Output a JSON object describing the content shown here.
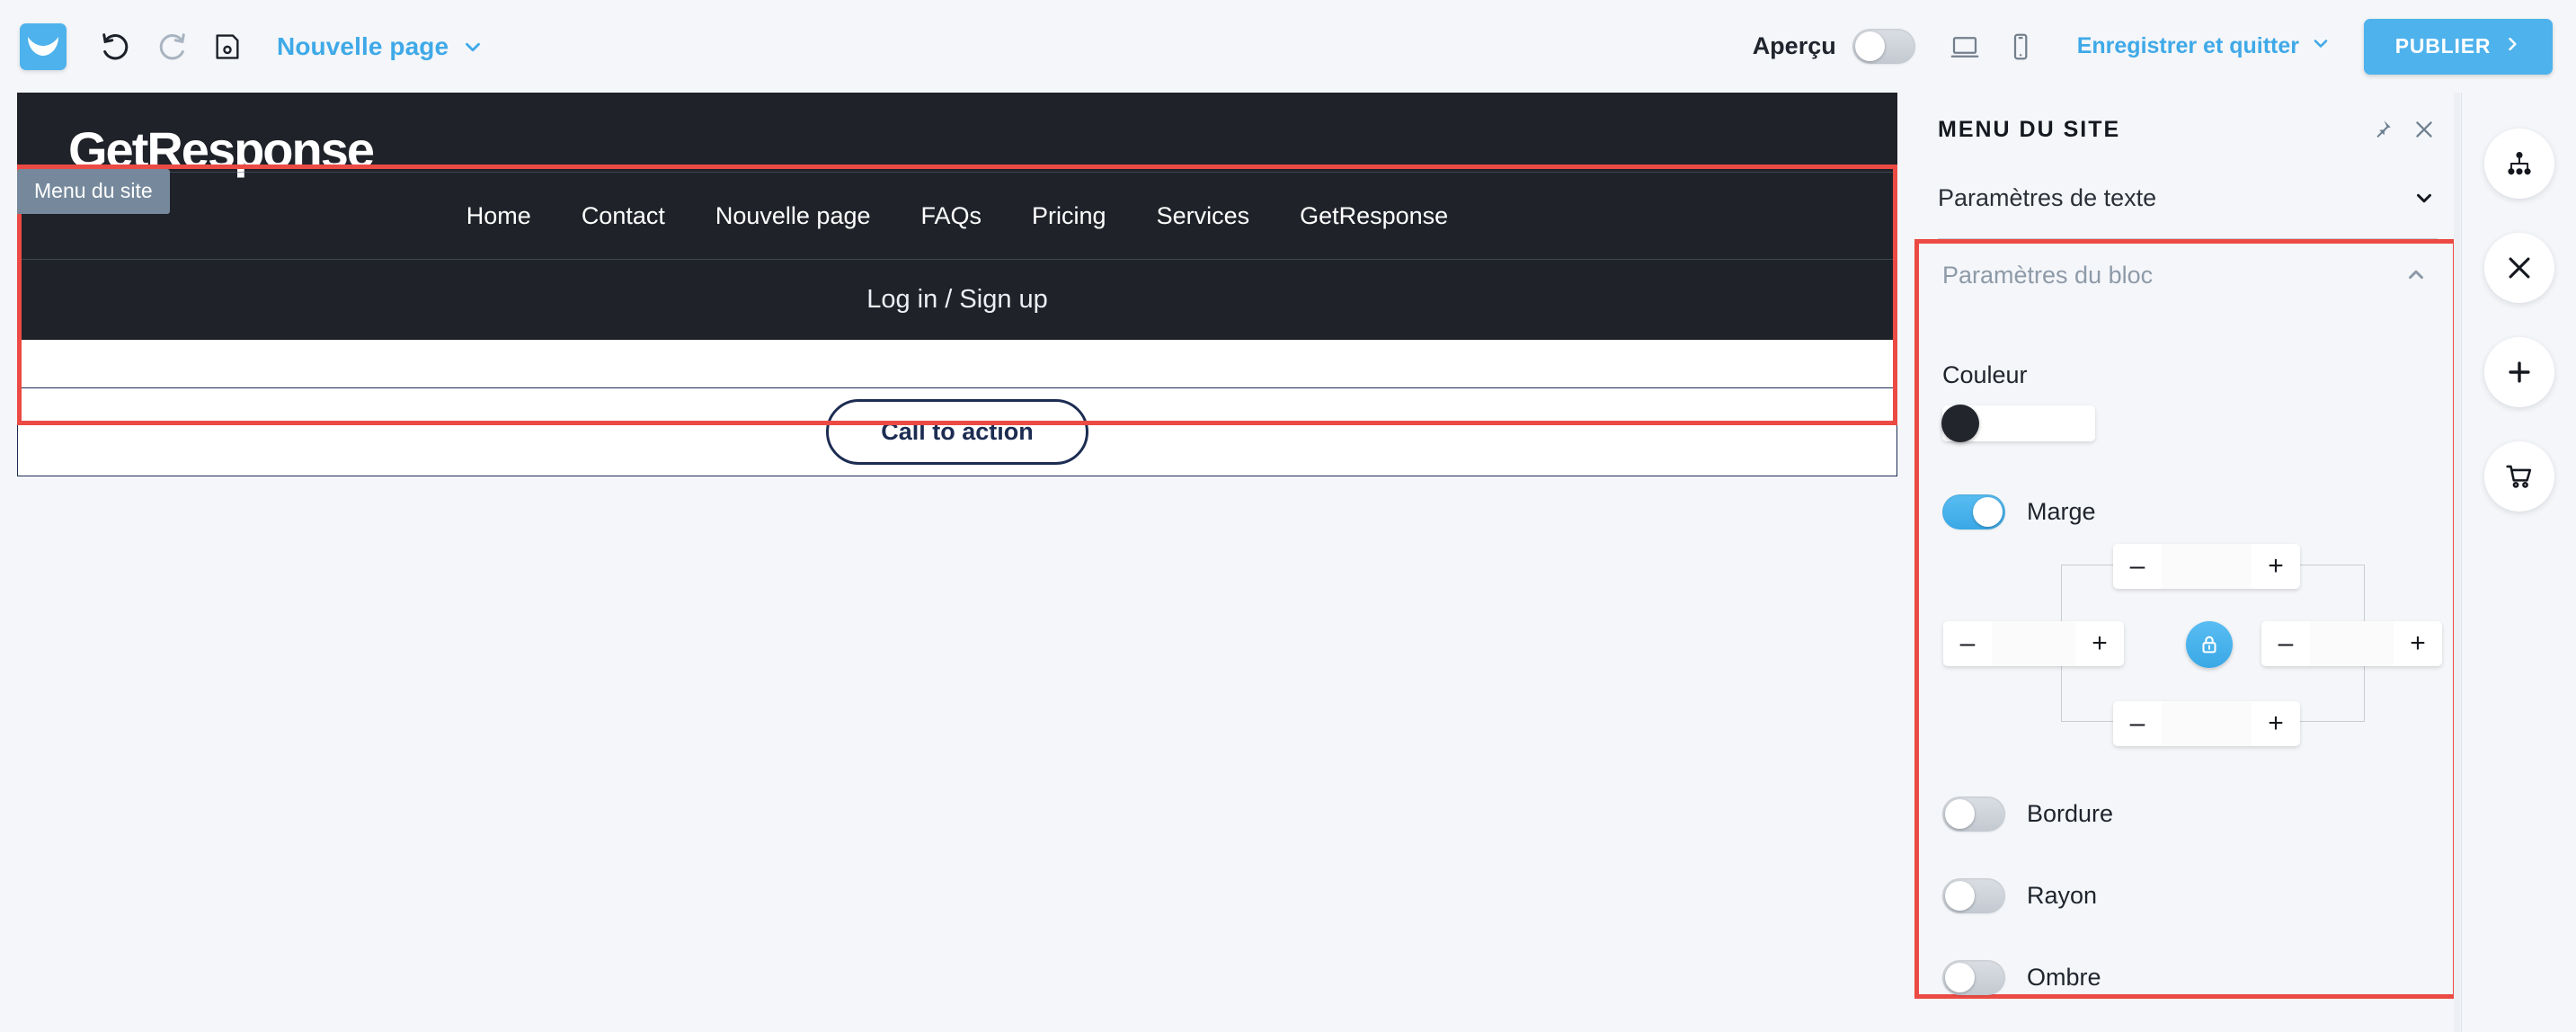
{
  "toolbar": {
    "logo_icon": "getresponse-logo-icon",
    "undo_icon": "undo-icon",
    "redo_icon": "redo-icon",
    "save_icon": "save-floppy-icon",
    "page_name": "Nouvelle page",
    "page_name_chevron_icon": "chevron-down-icon",
    "preview_label": "Aperçu",
    "preview_toggle_state": "off",
    "desktop_icon": "desktop-monitor-icon",
    "mobile_icon": "mobile-phone-icon",
    "save_quit_label": "Enregistrer et quitter",
    "save_quit_chevron_icon": "chevron-down-icon",
    "publish_label": "PUBLIER",
    "publish_arrow_icon": "chevron-right-icon",
    "accent_color": "#4eb2ec"
  },
  "canvas": {
    "selection_badge": "Menu du site",
    "selection_color": "#ec4a44",
    "site": {
      "brand_text": "GetResponse",
      "nav_links": [
        "Home",
        "Contact",
        "Nouvelle page",
        "FAQs",
        "Pricing",
        "Services",
        "GetResponse"
      ],
      "login_text": "Log in / Sign up",
      "cta_label": "Call to action",
      "header_bg": "#1f2229",
      "cta_border_color": "#1c2c52"
    }
  },
  "panel": {
    "title": "MENU DU SITE",
    "pin_icon": "pin-icon",
    "close_icon": "close-icon",
    "sections": {
      "text": {
        "label": "Paramètres de texte",
        "chevron_icon": "chevron-down-icon",
        "expanded": false
      },
      "block": {
        "label": "Paramètres du bloc",
        "chevron_icon": "chevron-up-icon",
        "expanded": true,
        "highlight_color": "#ec4a44"
      }
    },
    "block_settings": {
      "color_label": "Couleur",
      "color_value": "#22252c",
      "margin": {
        "label": "Marge",
        "toggle_state": "on",
        "lock_icon": "lock-icon",
        "lock_active": true,
        "minus_label": "–",
        "plus_label": "+",
        "top_value": "",
        "right_value": "",
        "bottom_value": "",
        "left_value": ""
      },
      "border": {
        "label": "Bordure",
        "toggle_state": "off"
      },
      "radius": {
        "label": "Rayon",
        "toggle_state": "off"
      },
      "shadow": {
        "label": "Ombre",
        "toggle_state": "off"
      }
    }
  },
  "rail": {
    "items": [
      {
        "icon": "sitemap-icon",
        "name": "sitemap"
      },
      {
        "icon": "close-cross-icon",
        "name": "close"
      },
      {
        "icon": "plus-icon",
        "name": "add"
      },
      {
        "icon": "shopping-cart-icon",
        "name": "cart"
      }
    ]
  }
}
